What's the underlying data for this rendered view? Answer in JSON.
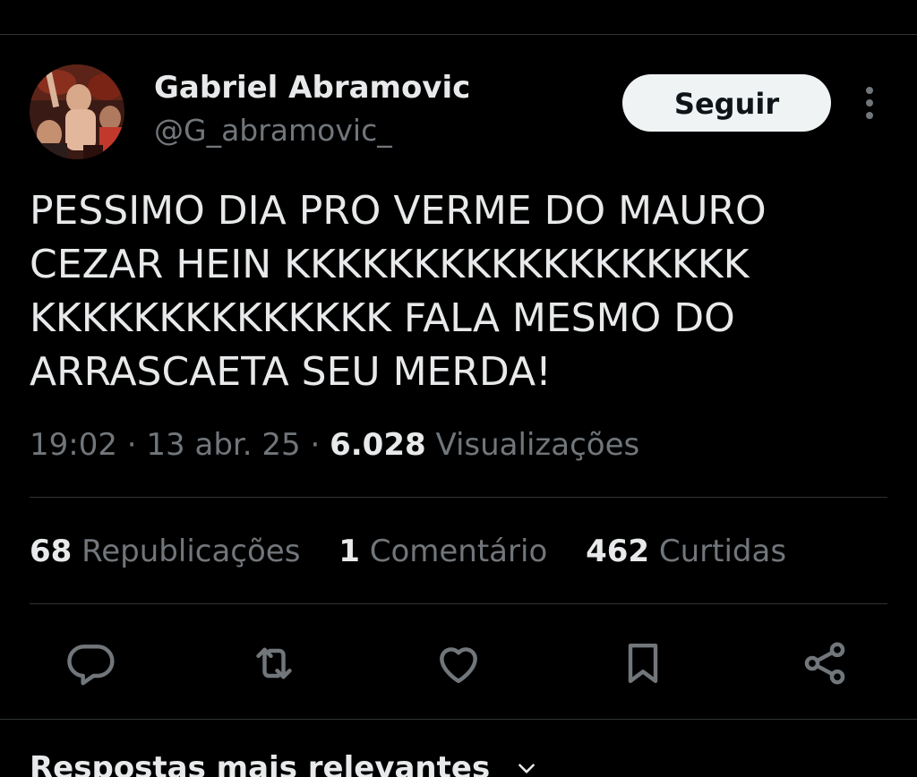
{
  "author": {
    "name": "Gabriel Abramovic",
    "handle": "@G_abramovic_"
  },
  "follow_button": {
    "label": "Seguir"
  },
  "tweet": {
    "text": "PESSIMO DIA PRO VERME DO MAURO CEZAR HEIN KKKKKKKKKKKKKKKKKK KKKKKKKKKKKKKK FALA MESMO DO ARRASCAETA SEU MERDA!"
  },
  "meta": {
    "time": "19:02",
    "separator": "·",
    "date": "13 abr. 25",
    "views_count": "6.028",
    "views_label": "Visualizações"
  },
  "stats": {
    "reposts_count": "68",
    "reposts_label": "Republicações",
    "comments_count": "1",
    "comments_label": "Comentário",
    "likes_count": "462",
    "likes_label": "Curtidas"
  },
  "icons": {
    "more": "more-vertical-icon",
    "reply": "reply-icon",
    "retweet": "retweet-icon",
    "like": "heart-icon",
    "bookmark": "bookmark-icon",
    "share": "share-icon",
    "chevron": "chevron-down-icon"
  },
  "colors": {
    "background": "#000000",
    "primary_text": "#e7e9ea",
    "secondary_text": "#71767b",
    "divider": "#2f3336",
    "follow_button_bg": "#eff3f4",
    "follow_button_text": "#0f1419"
  },
  "replies_section": {
    "heading": "Respostas mais relevantes"
  }
}
